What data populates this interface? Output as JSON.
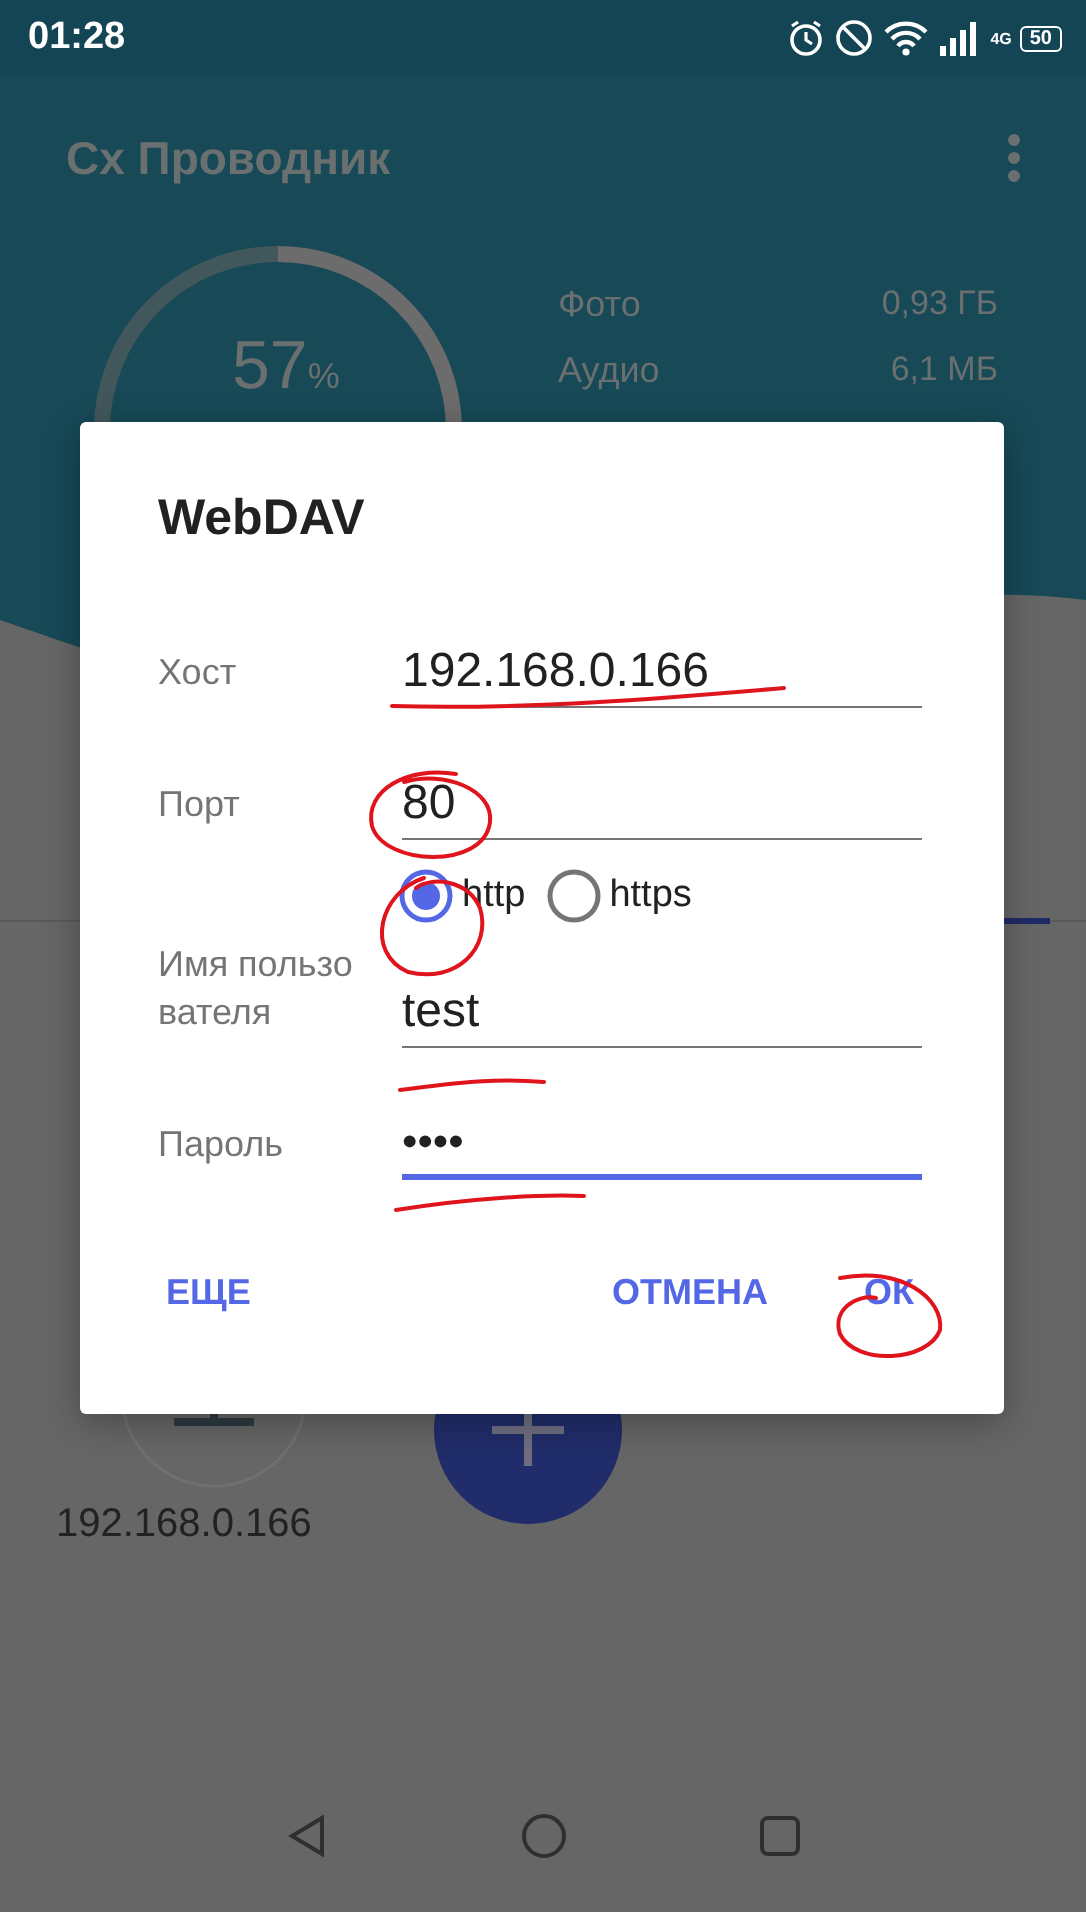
{
  "status_bar": {
    "time": "01:28",
    "network": "4G",
    "battery": "50"
  },
  "app_bar": {
    "title": "Сх Проводник"
  },
  "storage": {
    "percent": "57",
    "percent_sign": "%",
    "items": [
      {
        "label": "Фото",
        "value": "0,93 ГБ"
      },
      {
        "label": "Аудио",
        "value": "6,1 МБ"
      }
    ]
  },
  "background": {
    "device_label": "192.168.0.166"
  },
  "dialog": {
    "title": "WebDAV",
    "fields": [
      {
        "label": "Хост",
        "value": "192.168.0.166",
        "focused": false
      },
      {
        "label": "Порт",
        "value": "80",
        "focused": false
      }
    ],
    "protocols": [
      {
        "label": "http",
        "selected": true
      },
      {
        "label": "https",
        "selected": false
      }
    ],
    "credentials": [
      {
        "label": "Имя пользо вателя",
        "value": "test",
        "focused": false
      },
      {
        "label": "Пароль",
        "value": "••••",
        "focused": true
      }
    ],
    "buttons": [
      {
        "label": "ЕЩЕ",
        "kind": "neutral"
      },
      {
        "label": "ОТМЕНА",
        "kind": "negative"
      },
      {
        "label": "ОК",
        "kind": "positive"
      }
    ]
  }
}
